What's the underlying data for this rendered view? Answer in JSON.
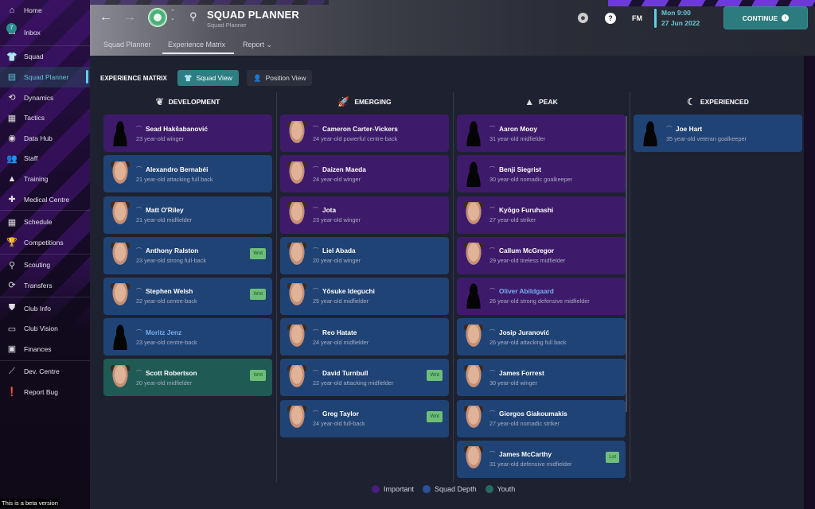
{
  "sidebar": {
    "items": [
      {
        "label": "Home",
        "icon": "home-icon"
      },
      {
        "label": "Inbox",
        "icon": "inbox-icon",
        "badge": "7"
      },
      {
        "label": "Squad",
        "icon": "shirt-icon"
      },
      {
        "label": "Squad Planner",
        "icon": "clipboard-icon",
        "active": true
      },
      {
        "label": "Dynamics",
        "icon": "dynamics-icon"
      },
      {
        "label": "Tactics",
        "icon": "tactics-icon"
      },
      {
        "label": "Data Hub",
        "icon": "data-hub-icon"
      },
      {
        "label": "Staff",
        "icon": "staff-icon"
      },
      {
        "label": "Training",
        "icon": "training-icon"
      },
      {
        "label": "Medical Centre",
        "icon": "medical-icon"
      },
      {
        "label": "Schedule",
        "icon": "calendar-icon"
      },
      {
        "label": "Competitions",
        "icon": "trophy-icon"
      },
      {
        "label": "Scouting",
        "icon": "search-icon"
      },
      {
        "label": "Transfers",
        "icon": "transfer-icon"
      },
      {
        "label": "Club Info",
        "icon": "shield-icon"
      },
      {
        "label": "Club Vision",
        "icon": "briefcase-icon"
      },
      {
        "label": "Finances",
        "icon": "money-icon"
      },
      {
        "label": "Dev. Centre",
        "icon": "dev-centre-icon"
      },
      {
        "label": "Report Bug",
        "icon": "exclamation-icon"
      }
    ],
    "beta_notice": "This is a beta version"
  },
  "header": {
    "title": "SQUAD PLANNER",
    "subtitle": "Squad Planner",
    "tabs": [
      {
        "label": "Squad Planner"
      },
      {
        "label": "Experience Matrix",
        "active": true
      },
      {
        "label": "Report ⌄"
      }
    ],
    "fm_label": "FM",
    "help_label": "?",
    "date_time": "Mon 9:00",
    "date_day": "27 Jun 2022",
    "continue_label": "CONTINUE"
  },
  "matrix": {
    "label": "EXPERIENCE MATRIX",
    "views": [
      {
        "label": "Squad View",
        "active": true
      },
      {
        "label": "Position View"
      }
    ],
    "columns": [
      {
        "title": "DEVELOPMENT",
        "icon": "sprout-icon",
        "players": [
          {
            "name": "Sead Hakšabanović",
            "desc": "23 year-old winger",
            "category": "important",
            "avatar": "silhouette"
          },
          {
            "name": "Alexandro Bernabéi",
            "desc": "21 year-old attacking full back",
            "category": "depth",
            "avatar": "face"
          },
          {
            "name": "Matt O'Riley",
            "desc": "21 year-old midfielder",
            "category": "depth",
            "avatar": "face"
          },
          {
            "name": "Anthony Ralston",
            "desc": "23 year-old strong full-back",
            "category": "depth",
            "avatar": "face",
            "tag": "Wnt"
          },
          {
            "name": "Stephen Welsh",
            "desc": "22 year-old centre-back",
            "category": "depth",
            "avatar": "face",
            "tag": "Wnt"
          },
          {
            "name": "Moritz Jenz",
            "desc": "23 year-old centre-back",
            "category": "depth",
            "avatar": "silhouette",
            "link": true
          },
          {
            "name": "Scott Robertson",
            "desc": "20 year-old midfielder",
            "category": "youth",
            "avatar": "face",
            "tag": "Wnt"
          }
        ]
      },
      {
        "title": "EMERGING",
        "icon": "rocket-icon",
        "players": [
          {
            "name": "Cameron Carter-Vickers",
            "desc": "24 year-old powerful centre-back",
            "category": "important",
            "avatar": "face"
          },
          {
            "name": "Daizen Maeda",
            "desc": "24 year-old winger",
            "category": "important",
            "avatar": "face"
          },
          {
            "name": "Jota",
            "desc": "23 year-old winger",
            "category": "important",
            "avatar": "face"
          },
          {
            "name": "Liel Abada",
            "desc": "20 year-old winger",
            "category": "depth",
            "avatar": "face"
          },
          {
            "name": "Yōsuke Ideguchi",
            "desc": "25 year-old midfielder",
            "category": "depth",
            "avatar": "face"
          },
          {
            "name": "Reo Hatate",
            "desc": "24 year-old midfielder",
            "category": "depth",
            "avatar": "face"
          },
          {
            "name": "David Turnbull",
            "desc": "22 year-old attacking midfielder",
            "category": "depth",
            "avatar": "face",
            "tag": "Wnt"
          },
          {
            "name": "Greg Taylor",
            "desc": "24 year-old full-back",
            "category": "depth",
            "avatar": "face",
            "tag": "Wnt"
          }
        ]
      },
      {
        "title": "PEAK",
        "icon": "mountain-icon",
        "players": [
          {
            "name": "Aaron Mooy",
            "desc": "31 year-old midfielder",
            "category": "important",
            "avatar": "silhouette"
          },
          {
            "name": "Benji Siegrist",
            "desc": "30 year-old nomadic goalkeeper",
            "category": "important",
            "avatar": "silhouette"
          },
          {
            "name": "Kyōgo Furuhashi",
            "desc": "27 year-old striker",
            "category": "important",
            "avatar": "face"
          },
          {
            "name": "Callum McGregor",
            "desc": "29 year-old tireless midfielder",
            "category": "important",
            "avatar": "face"
          },
          {
            "name": "Oliver Abildgaard",
            "desc": "26 year-old strong defensive midfielder",
            "category": "important",
            "avatar": "silhouette",
            "link": true
          },
          {
            "name": "Josip Juranović",
            "desc": "26 year-old attacking full back",
            "category": "depth",
            "avatar": "face"
          },
          {
            "name": "James Forrest",
            "desc": "30 year-old winger",
            "category": "depth",
            "avatar": "face"
          },
          {
            "name": "Giorgos Giakoumakis",
            "desc": "27 year-old nomadic striker",
            "category": "depth",
            "avatar": "face"
          },
          {
            "name": "James McCarthy",
            "desc": "31 year-old defensive midfielder",
            "category": "depth",
            "avatar": "face",
            "tag": "Lst"
          }
        ]
      },
      {
        "title": "EXPERIENCED",
        "icon": "moon-icon",
        "players": [
          {
            "name": "Joe Hart",
            "desc": "35 year-old veteran goalkeeper",
            "category": "depth",
            "avatar": "silhouette"
          }
        ]
      }
    ]
  },
  "legend": [
    {
      "label": "Important",
      "color": "#4a1e80"
    },
    {
      "label": "Squad Depth",
      "color": "#2a5296"
    },
    {
      "label": "Youth",
      "color": "#246a60"
    }
  ],
  "colors": {
    "accent": "#2d7e82",
    "highlight": "#5fd0e6",
    "important": "#3e1a6b",
    "depth": "#204375",
    "youth": "#1f5a55",
    "tag": "#6dbf78"
  }
}
